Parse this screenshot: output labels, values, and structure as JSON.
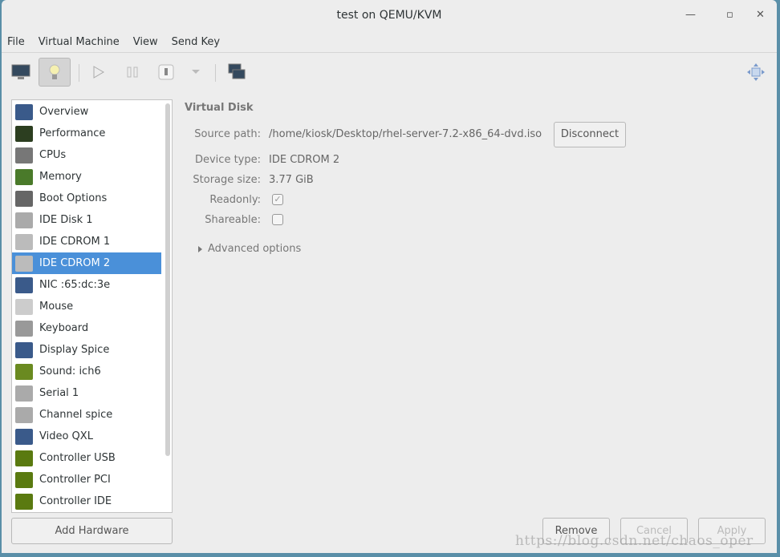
{
  "window": {
    "title": "test on QEMU/KVM",
    "minimize": "—",
    "maximize": "▫",
    "close": "✕"
  },
  "menu": [
    "File",
    "Virtual Machine",
    "View",
    "Send Key"
  ],
  "toolbar": {
    "icons": [
      "monitor-icon",
      "lightbulb-icon",
      "play-icon",
      "pause-icon",
      "power-icon",
      "dropdown-arrow-icon",
      "screenshot-icon",
      "fullscreen-icon"
    ]
  },
  "sidebar": {
    "selected": "IDE CDROM 2",
    "items": [
      {
        "label": "Overview",
        "color": "#3a5a8a"
      },
      {
        "label": "Performance",
        "color": "#2c3e20"
      },
      {
        "label": "CPUs",
        "color": "#777"
      },
      {
        "label": "Memory",
        "color": "#4a7a2a"
      },
      {
        "label": "Boot Options",
        "color": "#666"
      },
      {
        "label": "IDE Disk 1",
        "color": "#aaa"
      },
      {
        "label": "IDE CDROM 1",
        "color": "#bbb"
      },
      {
        "label": "IDE CDROM 2",
        "color": "#bbb"
      },
      {
        "label": "NIC :65:dc:3e",
        "color": "#3a5a8a"
      },
      {
        "label": "Mouse",
        "color": "#ccc"
      },
      {
        "label": "Keyboard",
        "color": "#999"
      },
      {
        "label": "Display Spice",
        "color": "#3a5a8a"
      },
      {
        "label": "Sound: ich6",
        "color": "#6a8a20"
      },
      {
        "label": "Serial 1",
        "color": "#aaa"
      },
      {
        "label": "Channel spice",
        "color": "#aaa"
      },
      {
        "label": "Video QXL",
        "color": "#3a5a8a"
      },
      {
        "label": "Controller USB",
        "color": "#5a7a10"
      },
      {
        "label": "Controller PCI",
        "color": "#5a7a10"
      },
      {
        "label": "Controller IDE",
        "color": "#5a7a10"
      }
    ],
    "add_hardware": "Add Hardware"
  },
  "details": {
    "section": "Virtual Disk",
    "source_path_label": "Source path:",
    "source_path": "/home/kiosk/Desktop/rhel-server-7.2-x86_64-dvd.iso",
    "disconnect": "Disconnect",
    "device_type_label": "Device type:",
    "device_type": "IDE CDROM 2",
    "storage_size_label": "Storage size:",
    "storage_size": "3.77 GiB",
    "readonly_label": "Readonly:",
    "readonly": true,
    "shareable_label": "Shareable:",
    "shareable": false,
    "advanced": "Advanced options"
  },
  "footer": {
    "remove": "Remove",
    "cancel": "Cancel",
    "apply": "Apply"
  },
  "watermark": "https://blog.csdn.net/chaos_oper",
  "colors": {
    "selection": "#4a90d9"
  }
}
